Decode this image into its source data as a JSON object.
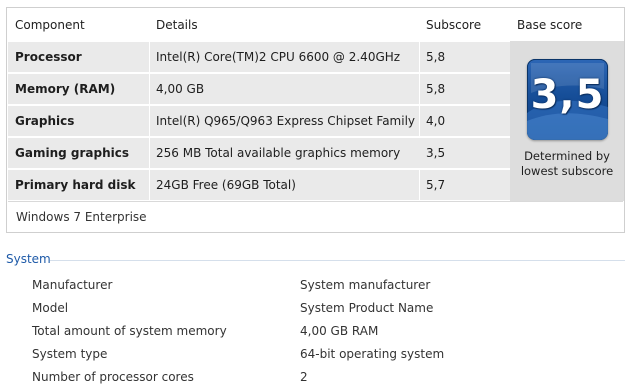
{
  "headers": {
    "component": "Component",
    "details": "Details",
    "subscore": "Subscore",
    "base_score": "Base score"
  },
  "rows": [
    {
      "component": "Processor",
      "details": "Intel(R) Core(TM)2 CPU 6600 @ 2.40GHz",
      "subscore": "5,8"
    },
    {
      "component": "Memory (RAM)",
      "details": "4,00 GB",
      "subscore": "5,8"
    },
    {
      "component": "Graphics",
      "details": "Intel(R) Q965/Q963 Express Chipset Family",
      "subscore": "4,0"
    },
    {
      "component": "Gaming graphics",
      "details": "256 MB Total available graphics memory",
      "subscore": "3,5"
    },
    {
      "component": "Primary hard disk",
      "details": "24GB Free (69GB Total)",
      "subscore": "5,7"
    }
  ],
  "base_score": {
    "value": "3,5",
    "caption_line1": "Determined by",
    "caption_line2": "lowest subscore",
    "badge_icon": "windows-experience-index-badge"
  },
  "edition": "Windows 7 Enterprise",
  "system": {
    "title": "System",
    "items": [
      {
        "label": "Manufacturer",
        "value": "System manufacturer"
      },
      {
        "label": "Model",
        "value": "System Product Name"
      },
      {
        "label": "Total amount of system memory",
        "value": "4,00 GB RAM"
      },
      {
        "label": "System type",
        "value": "64-bit operating system"
      },
      {
        "label": "Number of processor cores",
        "value": "2"
      }
    ]
  },
  "colors": {
    "row_bg": "#eaeaea",
    "row_bg_lowest": "#dddddd",
    "section_title": "#1e5aa8",
    "badge_blue": "#164e98"
  }
}
